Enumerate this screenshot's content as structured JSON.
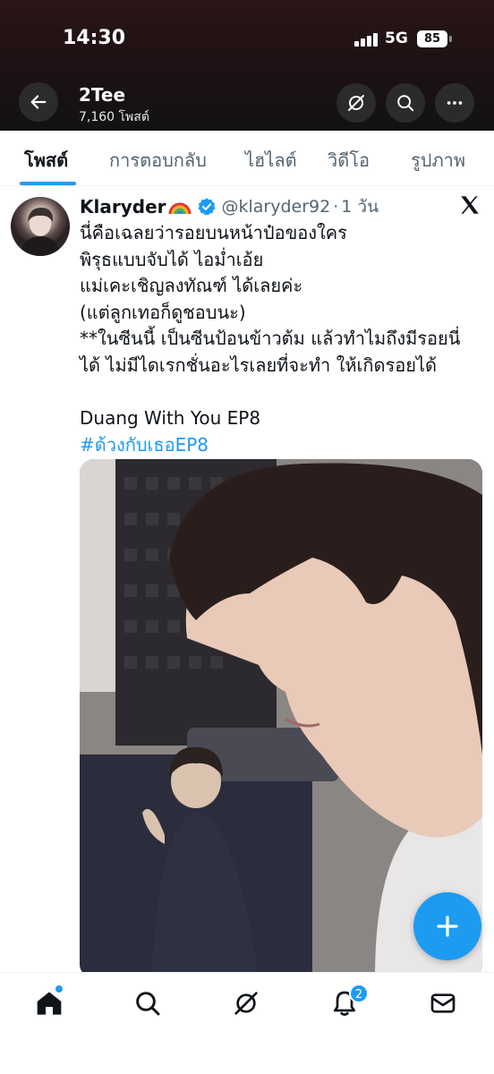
{
  "status_bar": {
    "time": "14:30",
    "network": "5G",
    "battery": "85"
  },
  "header": {
    "profile_name": "2Tee",
    "post_count": "7,160 โพสต์"
  },
  "tabs": [
    {
      "label": "โพสต์",
      "active": true
    },
    {
      "label": "การตอบกลับ",
      "active": false
    },
    {
      "label": "ไฮไลต์",
      "active": false
    },
    {
      "label": "วิดีโอ",
      "active": false
    },
    {
      "label": "รูปภาพ",
      "active": false
    }
  ],
  "post": {
    "author": "Klaryder",
    "handle": "@klaryder92",
    "separator": "·",
    "time": "1 วัน",
    "lines": [
      "นี่คือเฉลยว่ารอยบนหน้าป๋อของใคร",
      "พิรุธแบบจับได้ ไอม่ำเอ้ย",
      "แม่เคะเชิญลงทัณฑ์ ได้เลยค่ะ",
      "(แต่ลูกเทอก็ดูชอบนะ)",
      "**ในซีนนี้ เป็นซีนป้อนข้าวต้ม แล้วทำไมถึงมีรอยนี่",
      "ได้ ไม่มีไดเรกชั่นอะไรเลยที่จะทำ ให้เกิดรอยได้"
    ],
    "series_title": "Duang With You EP8",
    "hashtag": "#ด้วงกับเธอEP8"
  },
  "bottom_nav": {
    "notification_count": "2"
  },
  "colors": {
    "accent": "#1d9bf0",
    "text": "#0f1419",
    "muted": "#536471",
    "header_bg": "#1d1113"
  },
  "icons": [
    "back-arrow-icon",
    "grok-icon",
    "search-icon",
    "more-icon",
    "verified-icon",
    "x-logo-icon",
    "plus-icon",
    "home-icon",
    "notifications-icon",
    "mail-icon"
  ]
}
